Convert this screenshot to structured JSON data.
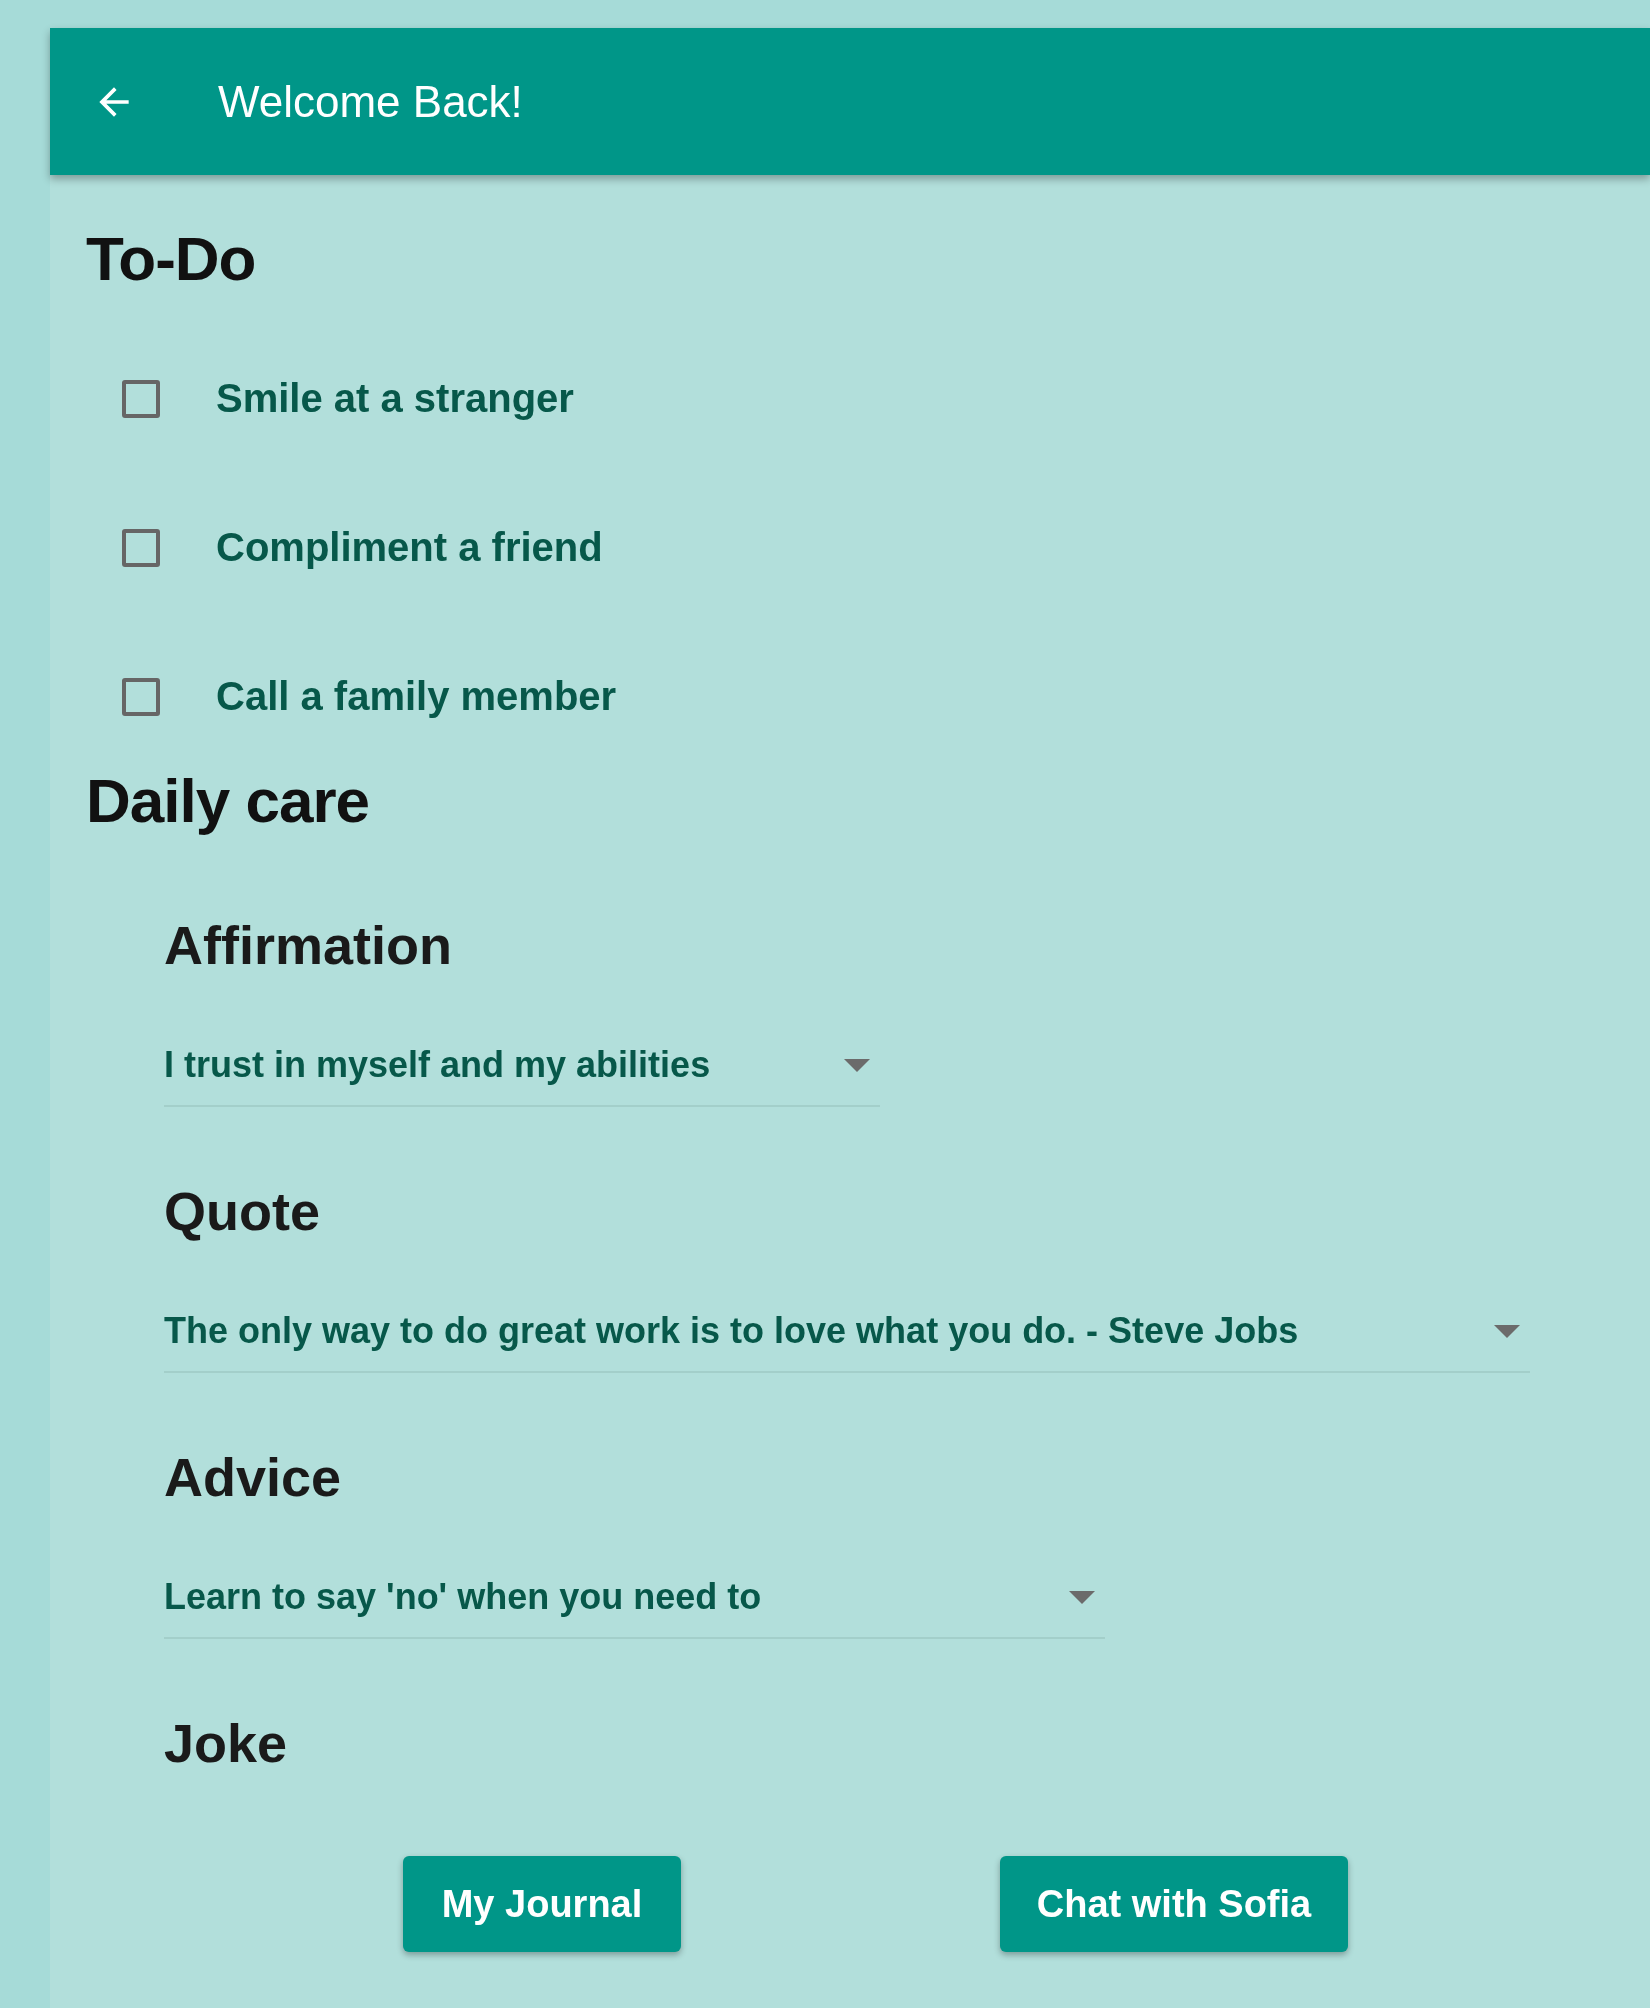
{
  "app_bar": {
    "title": "Welcome Back!"
  },
  "todo": {
    "heading": "To-Do",
    "items": [
      {
        "label": "Smile at a stranger",
        "checked": false
      },
      {
        "label": "Compliment a friend",
        "checked": false
      },
      {
        "label": "Call a family member",
        "checked": false
      }
    ]
  },
  "daily_care": {
    "heading": "Daily care",
    "sections": [
      {
        "heading": "Affirmation",
        "value": "I trust in myself and my abilities"
      },
      {
        "heading": "Quote",
        "value": "The only way to do great work is to love what you do. - Steve Jobs"
      },
      {
        "heading": "Advice",
        "value": "Learn to say 'no' when you need to"
      },
      {
        "heading": "Joke"
      }
    ]
  },
  "buttons": [
    "My Journal",
    "Chat with Sofia"
  ]
}
